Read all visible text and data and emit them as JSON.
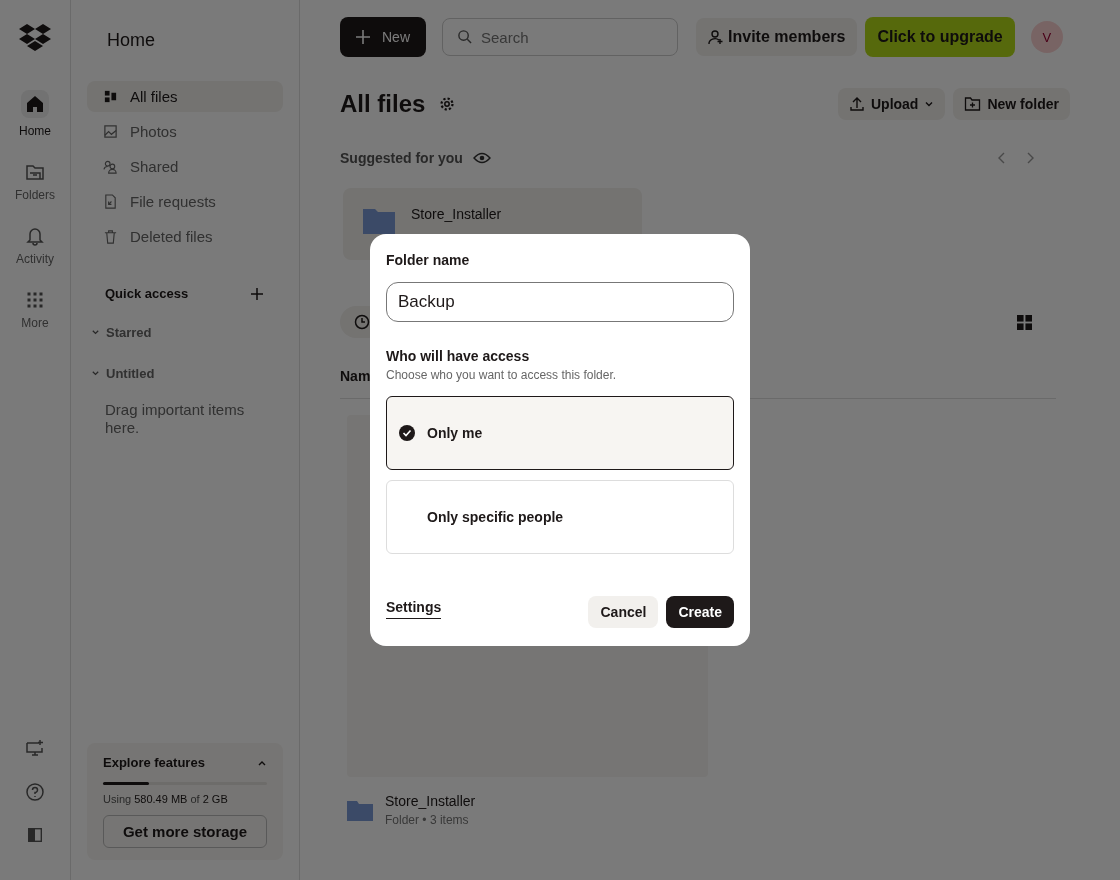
{
  "rail": {
    "items": [
      {
        "kind": "home",
        "label": "Home",
        "selected": true
      },
      {
        "kind": "folders",
        "label": "Folders",
        "selected": false
      },
      {
        "kind": "activity",
        "label": "Activity",
        "selected": false
      },
      {
        "kind": "more",
        "label": "More",
        "selected": false
      }
    ]
  },
  "sidebar": {
    "title": "Home",
    "items": [
      {
        "kind": "all",
        "label": "All files",
        "selected": true
      },
      {
        "kind": "photos",
        "label": "Photos",
        "selected": false
      },
      {
        "kind": "shared",
        "label": "Shared",
        "selected": false
      },
      {
        "kind": "requests",
        "label": "File requests",
        "selected": false
      },
      {
        "kind": "deleted",
        "label": "Deleted files",
        "selected": false
      }
    ],
    "quick_access": "Quick access",
    "sections": [
      {
        "label": "Starred",
        "expanded": true
      },
      {
        "label": "Untitled",
        "expanded": true
      }
    ],
    "hint": "Drag important items here.",
    "explore": {
      "title": "Explore features",
      "expanded": true,
      "level": 0.283,
      "usage": "Using **580.49 MB** of **2 GB**",
      "button": "Get more storage"
    }
  },
  "topbar": {
    "new_button": "New",
    "search": {
      "placeholder": "Search"
    },
    "invite": "Invite members",
    "upgrade": "Click to upgrade",
    "avatar": "V"
  },
  "page": {
    "title": "All files",
    "actions": [
      {
        "kind": "upload",
        "label": "Upload"
      },
      {
        "kind": "folder",
        "label": "New folder"
      }
    ],
    "suggested": {
      "label": "Suggested for you",
      "items": [
        {
          "name": "Store_Installer"
        }
      ]
    },
    "table": {
      "column_1": "Nam"
    },
    "files": [
      {
        "name": "Store_Installer",
        "meta": "Folder • 3 items"
      }
    ]
  },
  "dialog": {
    "label": "Folder name",
    "value": "Backup",
    "access_title": "Who will have access",
    "access_hint": "Choose who you want to access this folder.",
    "options": [
      {
        "label": "Only me",
        "selected": true
      },
      {
        "label": "Only specific people",
        "selected": false
      }
    ],
    "settings": "Settings",
    "buttons": [
      "Cancel",
      "Create"
    ]
  }
}
